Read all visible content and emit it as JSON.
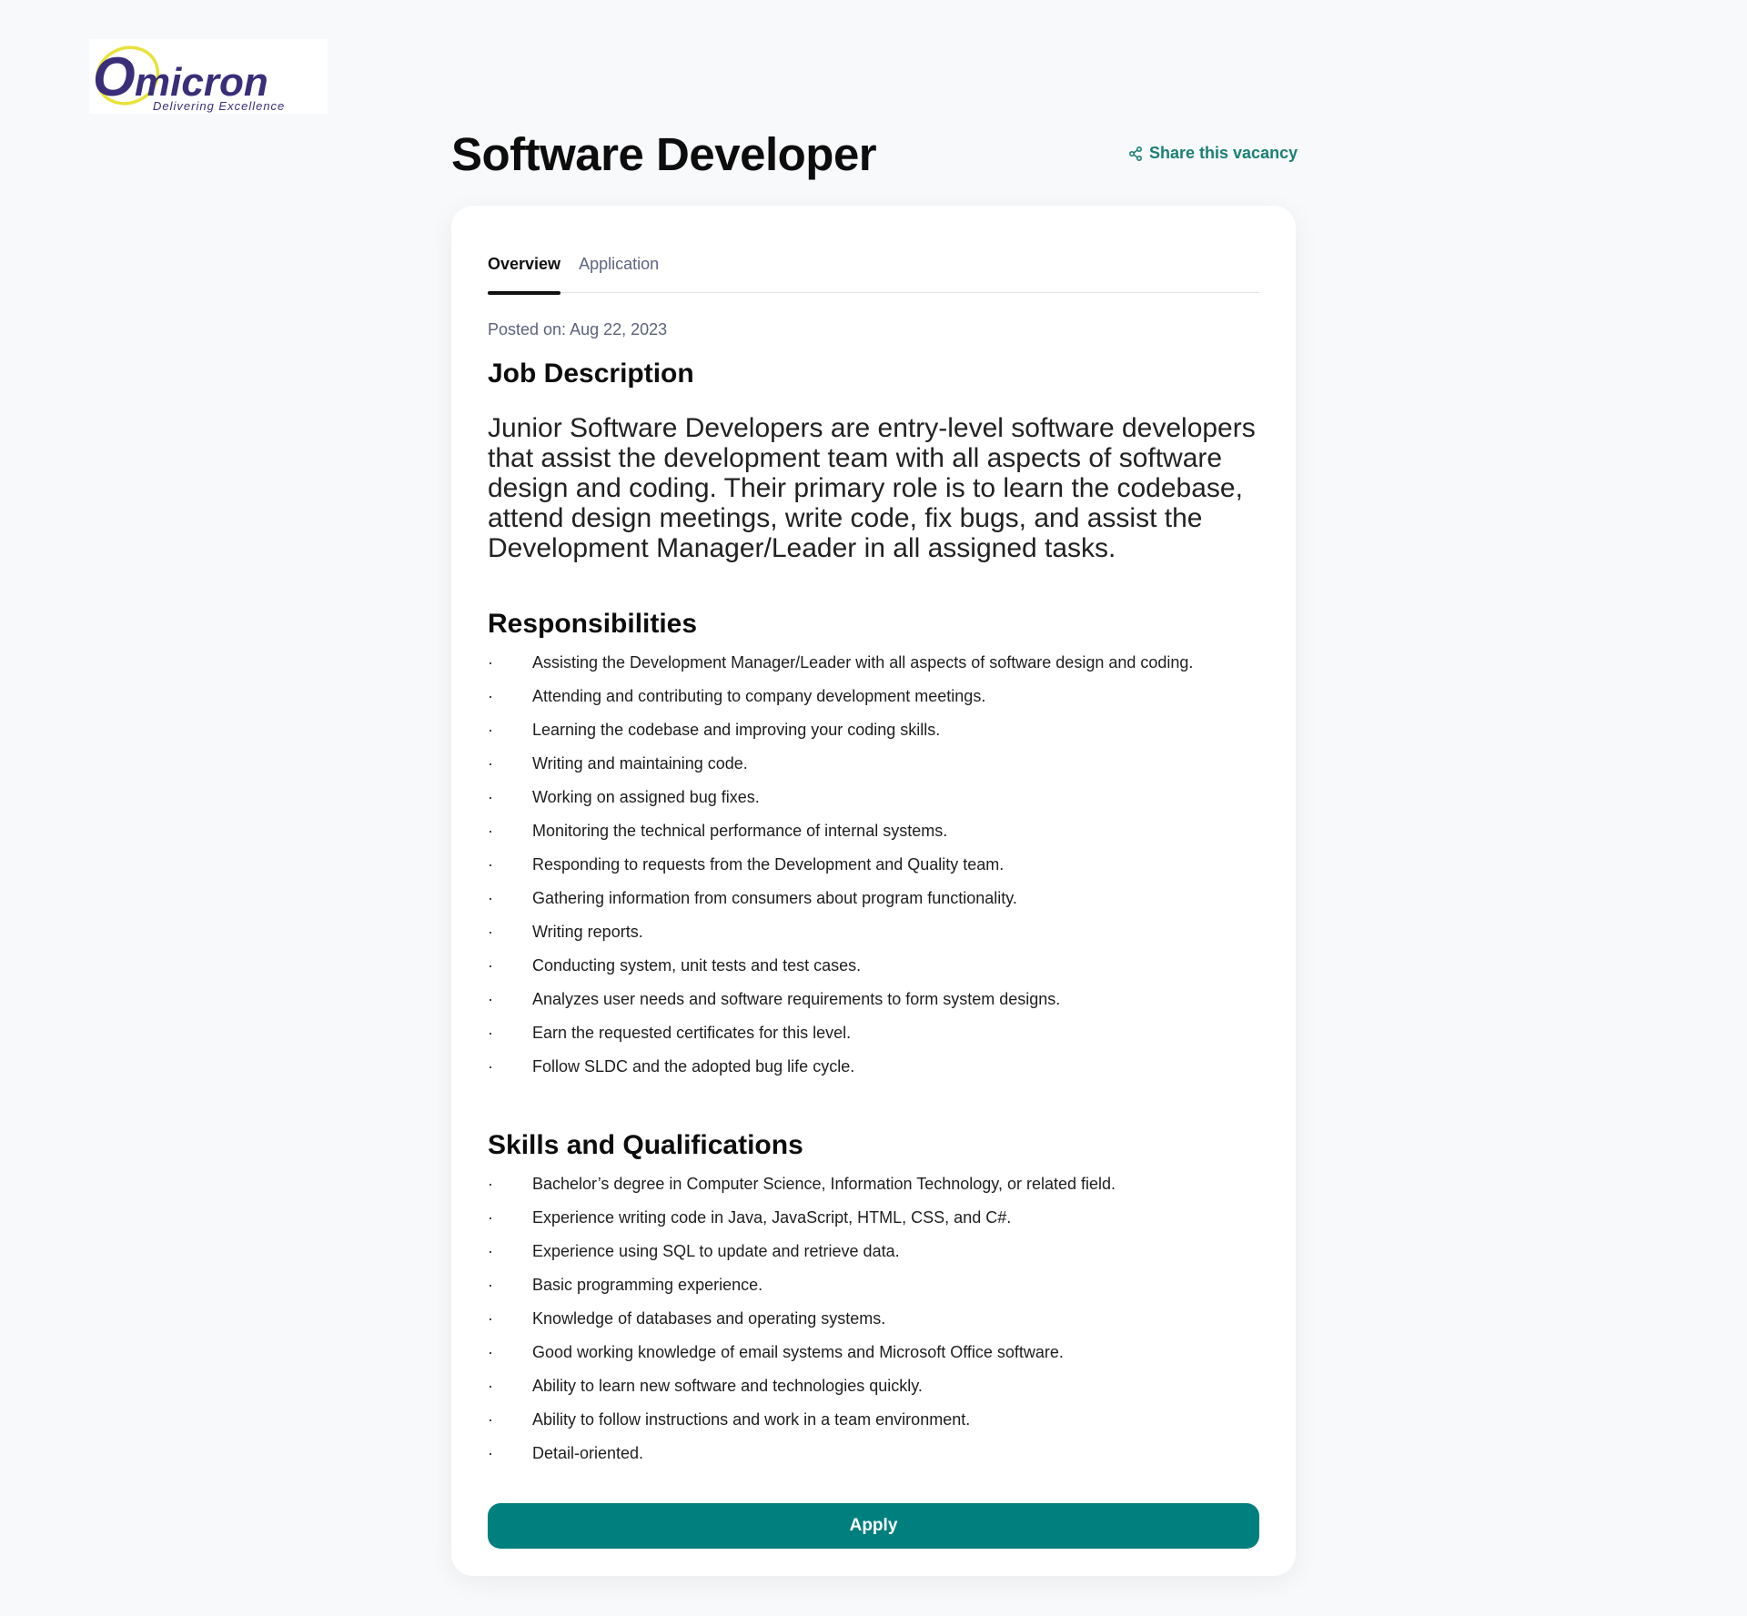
{
  "brand": {
    "logo_text": "Omicron",
    "tagline": "Delivering Excellence",
    "logo_colors": {
      "primary": "#3a2e7a",
      "accent": "#e8e23a"
    }
  },
  "header": {
    "title": "Software Developer",
    "share_label": "Share this vacancy",
    "share_icon": "share-icon"
  },
  "tabs": [
    {
      "label": "Overview",
      "active": true
    },
    {
      "label": "Application",
      "active": false
    }
  ],
  "posted": "Posted on: Aug 22, 2023",
  "job_description": {
    "heading": "Job Description",
    "text": "Junior Software Developers are entry-level software developers that assist the development team with all aspects of software design and coding. Their primary role is to learn the codebase, attend design meetings, write code, fix bugs, and assist the Development Manager/Leader in all assigned tasks."
  },
  "responsibilities": {
    "heading": "Responsibilities",
    "bullet": "·",
    "items": [
      "Assisting the Development Manager/Leader with all aspects of software design and coding.",
      "Attending and contributing to company development meetings.",
      "Learning the codebase and improving your coding skills.",
      "Writing and maintaining code.",
      "Working on assigned bug fixes.",
      "Monitoring the technical performance of internal systems.",
      "Responding to requests from the Development and Quality team.",
      "Gathering information from consumers about program functionality.",
      "Writing reports.",
      "Conducting system, unit tests and test cases.",
      "Analyzes user needs and software requirements to form system designs.",
      "Earn the requested certificates for this level.",
      "Follow SLDC and the adopted bug life cycle."
    ]
  },
  "skills": {
    "heading": "Skills and Qualifications",
    "bullet": "·",
    "items": [
      "Bachelor’s degree in Computer Science, Information Technology, or related field.",
      "Experience writing code in Java, JavaScript, HTML, CSS, and C#.",
      "Experience using SQL to update and retrieve data.",
      "Basic programming experience.",
      "Knowledge of databases and operating systems.",
      "Good working knowledge of email systems and Microsoft Office software.",
      "Ability to learn new software and technologies quickly.",
      "Ability to follow instructions and work in a team environment.",
      "Detail-oriented."
    ]
  },
  "apply_label": "Apply",
  "colors": {
    "accent": "#007f7f",
    "share_text": "#1a8074",
    "background": "#f8f9fb"
  }
}
